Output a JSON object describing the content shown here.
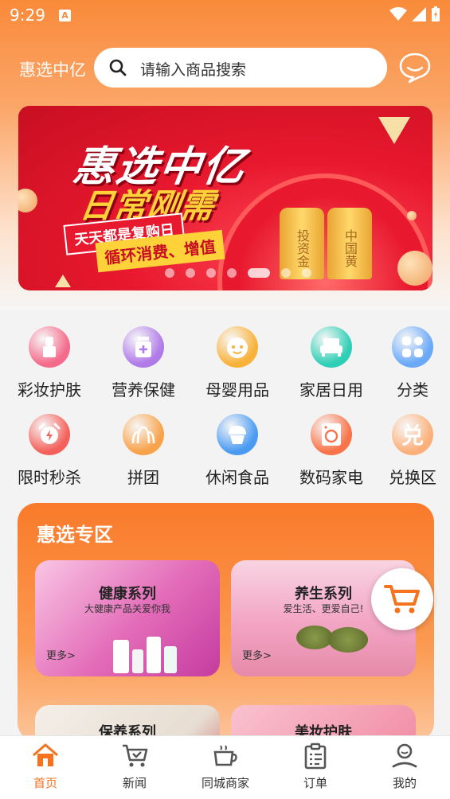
{
  "status": {
    "time": "9:29",
    "badge": "A"
  },
  "header": {
    "brand": "惠选中亿",
    "search_placeholder": "请输入商品搜索"
  },
  "banner": {
    "title": "惠选中亿",
    "subtitle": "日常刚需",
    "ribbon1": "天天都是复购日",
    "ribbon2": "循环消费、增值",
    "gold_bar_1": "投资金",
    "gold_bar_2": "中国黄",
    "slide_count": 7,
    "active_slide": 4
  },
  "categories": [
    {
      "label": "彩妆护肤",
      "icon": "lipstick-icon",
      "color": "#f46a8a"
    },
    {
      "label": "营养保健",
      "icon": "medicine-bottle-icon",
      "color": "#b07ae8"
    },
    {
      "label": "母婴用品",
      "icon": "baby-face-icon",
      "color": "#f8b23a"
    },
    {
      "label": "家居日用",
      "icon": "sofa-icon",
      "color": "#2fcfb6"
    },
    {
      "label": "分类",
      "icon": "grid-icon",
      "color": "#6aa8f8"
    },
    {
      "label": "限时秒杀",
      "icon": "alarm-clock-icon",
      "color": "#f4615c"
    },
    {
      "label": "拼团",
      "icon": "group-icon",
      "color": "#f8a24a"
    },
    {
      "label": "休闲食品",
      "icon": "cupcake-icon",
      "color": "#4a9af2"
    },
    {
      "label": "数码家电",
      "icon": "washing-machine-icon",
      "color": "#f8734a"
    },
    {
      "label": "兑换区",
      "icon": "exchange-char-icon",
      "color": "#fbb07a",
      "glyph": "兑"
    }
  ],
  "zone": {
    "title": "惠选专区",
    "cards": [
      {
        "title": "健康系列",
        "subtitle": "大健康产品关爱你我",
        "more": "更多>"
      },
      {
        "title": "养生系列",
        "subtitle": "爱生活、更爱自己!",
        "more": "更多>"
      },
      {
        "title": "保养系列",
        "subtitle": "",
        "more": ""
      },
      {
        "title": "美妆护肤",
        "subtitle": "",
        "more": ""
      }
    ]
  },
  "tabbar": [
    {
      "label": "首页",
      "icon": "home-icon",
      "active": true
    },
    {
      "label": "新闻",
      "icon": "cart-check-icon",
      "active": false
    },
    {
      "label": "同城商家",
      "icon": "coffee-cup-icon",
      "active": false
    },
    {
      "label": "订单",
      "icon": "clipboard-icon",
      "active": false
    },
    {
      "label": "我的",
      "icon": "user-icon",
      "active": false
    }
  ],
  "colors": {
    "primary": "#f98a3a",
    "active_tab": "#f5731f"
  }
}
